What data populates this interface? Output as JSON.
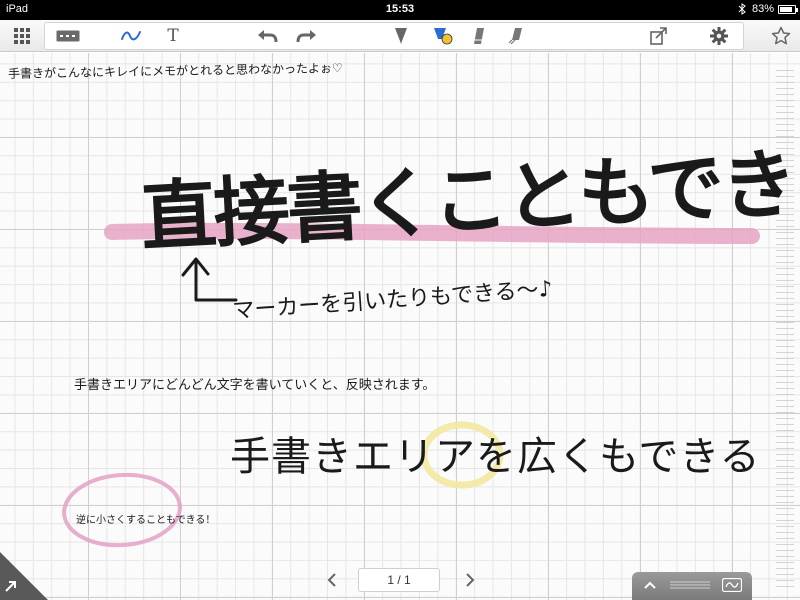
{
  "status_bar": {
    "device": "iPad",
    "time": "15:53",
    "battery": "83%",
    "battery_level": 0.83
  },
  "toolbar": {
    "text_tool_glyph": "T"
  },
  "canvas": {
    "note_top": "手書きがこんなにキレイにメモがとれると思わなかったよぉ♡",
    "big_text": "直接書くこともできる。",
    "marker_note": "マーカーを引いたりもできる～♪",
    "info_note": "手書きエリアにどんどん文字を書いていくと、反映されます。",
    "area_text": "手書きエリアを広くもできる",
    "small_note": "逆に小さくすることもできる！"
  },
  "pagination": {
    "indicator": "1 / 1"
  },
  "colors": {
    "marker_pink": "#e6a3c4",
    "circle_pink": "#e3a0c6",
    "highlight_yellow": "#f3e8a0",
    "pen_active": "#2a6ed2"
  }
}
